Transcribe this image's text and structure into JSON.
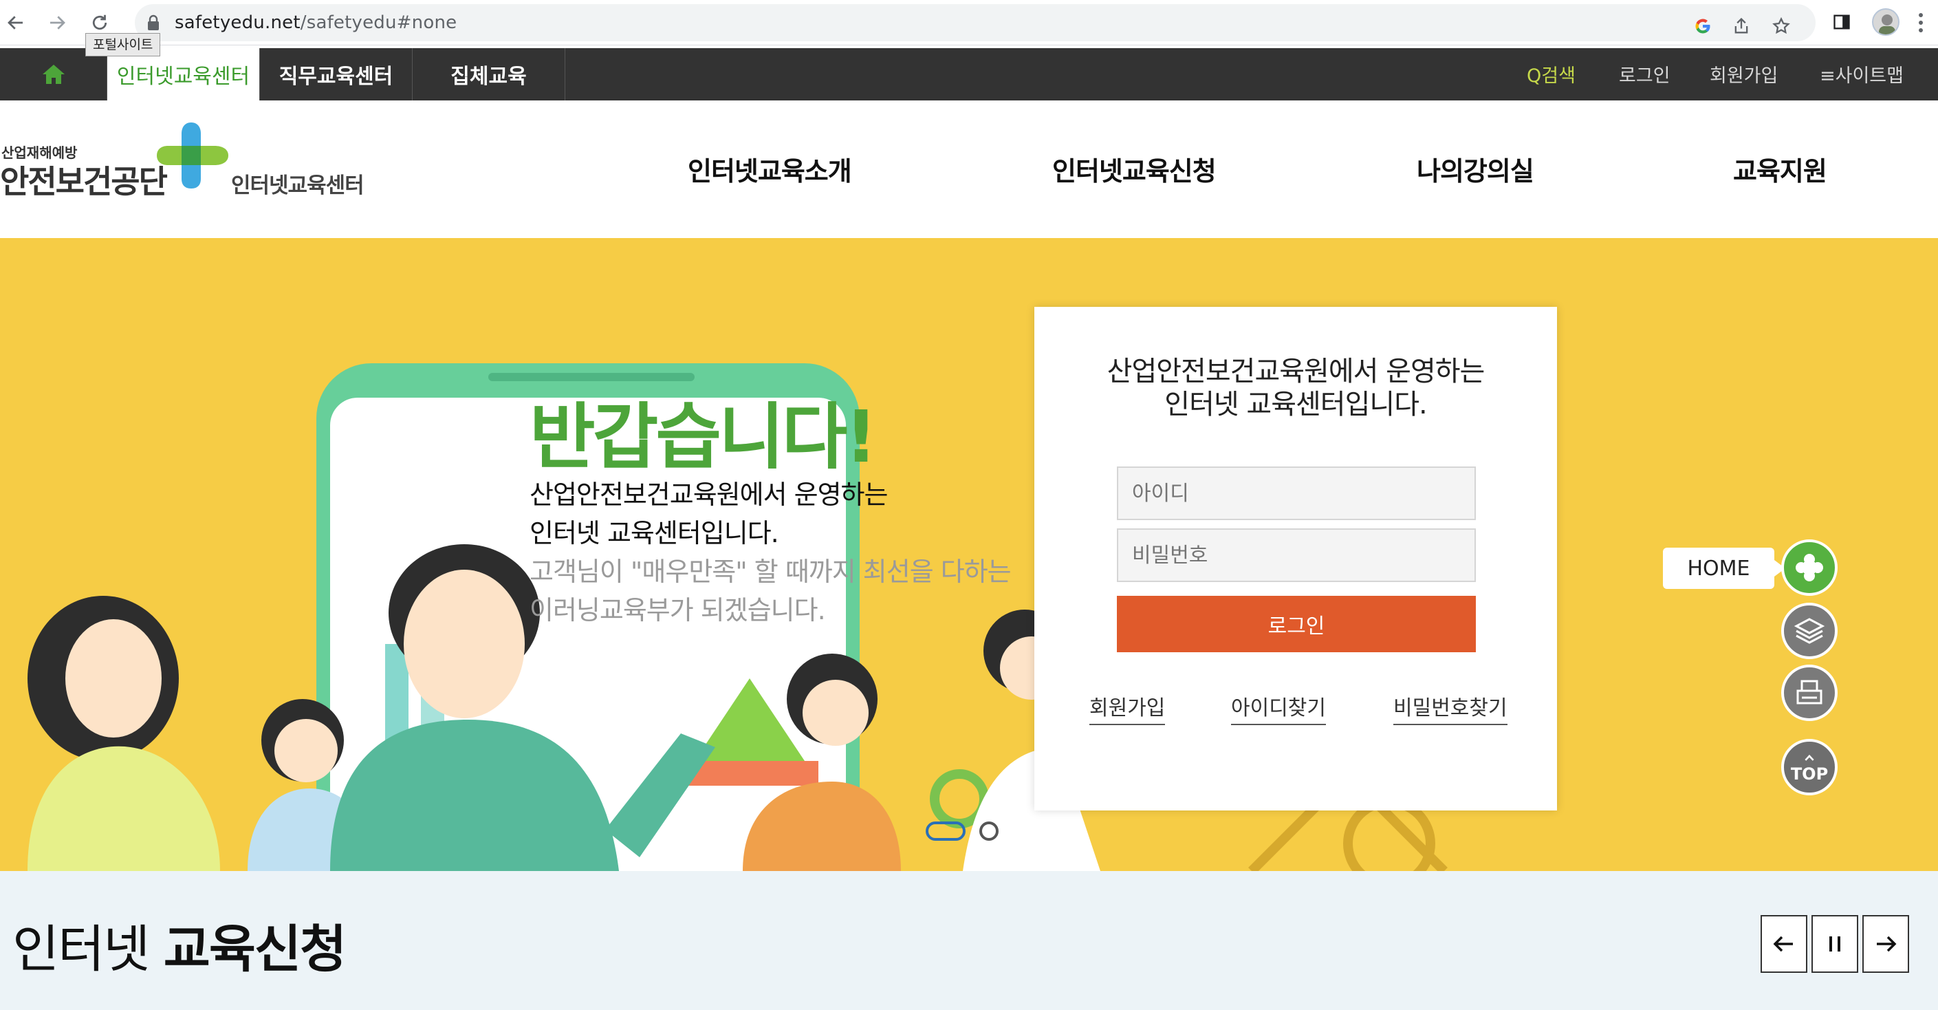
{
  "browser": {
    "url_host": "safetyedu.net",
    "url_path": "/safetyedu#none"
  },
  "topbar": {
    "tabs": [
      {
        "label": "인터넷교육센터",
        "active": true
      },
      {
        "label": "직무교육센터"
      },
      {
        "label": "집체교육"
      }
    ],
    "tooltip": "포털사이트",
    "utils": {
      "search": "Q검색",
      "login": "로그인",
      "signup": "회원가입",
      "sitemap": "≡사이트맵"
    }
  },
  "header": {
    "logo_small": "산업재해예방",
    "logo_big": "안전보건공단",
    "logo_sub": "인터넷교육센터",
    "menu": [
      "인터넷교육소개",
      "인터넷교육신청",
      "나의강의실",
      "교육지원"
    ]
  },
  "hero": {
    "title": "반갑습니다!",
    "line1": "산업안전보건교육원에서 운영하는",
    "line2": "인터넷 교육센터입니다.",
    "line3": "고객님이 \"매우만족\" 할 때까지 최선을 다하는",
    "line4": "이러닝교육부가 되겠습니다."
  },
  "login": {
    "heading_line1": "산업안전보건교육원에서 운영하는",
    "heading_line2": "인터넷 교육센터입니다.",
    "id_placeholder": "아이디",
    "pw_placeholder": "비밀번호",
    "button": "로그인",
    "links": [
      "회원가입",
      "아이디찾기",
      "비밀번호찾기"
    ]
  },
  "quick_menu": {
    "home_label": "HOME",
    "top_label": "TOP"
  },
  "section": {
    "title_light": "인터넷 ",
    "title_bold": "교육신청"
  },
  "colors": {
    "accent_green": "#4da53a",
    "hero_yellow": "#f6cc45",
    "login_orange": "#e05a2b",
    "topbar_dark": "#333333"
  }
}
